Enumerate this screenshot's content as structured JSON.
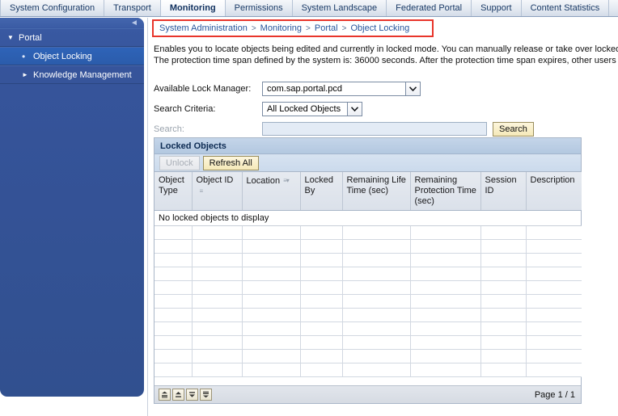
{
  "topnav": {
    "tabs": [
      {
        "label": "System Configuration",
        "active": false
      },
      {
        "label": "Transport",
        "active": false
      },
      {
        "label": "Monitoring",
        "active": true
      },
      {
        "label": "Permissions",
        "active": false
      },
      {
        "label": "System Landscape",
        "active": false
      },
      {
        "label": "Federated Portal",
        "active": false
      },
      {
        "label": "Support",
        "active": false
      },
      {
        "label": "Content Statistics",
        "active": false
      }
    ]
  },
  "sidebar": {
    "collapse_icon": "◄",
    "items": [
      {
        "label": "Portal",
        "icon": "▼",
        "level": 0,
        "selected": false
      },
      {
        "label": "Object Locking",
        "icon": "•",
        "level": 1,
        "selected": true
      },
      {
        "label": "Knowledge Management",
        "icon": "►",
        "level": 1,
        "selected": false
      }
    ]
  },
  "breadcrumb": {
    "highlight_color": "#e8352b",
    "separator": ">",
    "items": [
      "System Administration",
      "Monitoring",
      "Portal",
      "Object Locking"
    ]
  },
  "description": {
    "line1": "Enables you to locate objects being edited and currently in locked mode. You can manually release or take over locked",
    "line2": "The protection time span defined by the system is: 36000 seconds. After the protection time span expires, other users"
  },
  "form": {
    "lock_manager_label": "Available Lock Manager:",
    "lock_manager_value": "com.sap.portal.pcd",
    "search_criteria_label": "Search Criteria:",
    "search_criteria_value": "All Locked Objects",
    "search_label": "Search:",
    "search_value": "",
    "search_placeholder": "",
    "search_button": "Search",
    "dropdown_arrow": "⌄"
  },
  "panel": {
    "title": "Locked Objects",
    "unlock_button": "Unlock",
    "refresh_button": "Refresh All",
    "columns": [
      {
        "label": "Object Type",
        "sort": ""
      },
      {
        "label": "Object ID",
        "sort": "≡"
      },
      {
        "label": "Location",
        "sort": "≡▾"
      },
      {
        "label": "Locked By",
        "sort": ""
      },
      {
        "label": "Remaining Life Time (sec)",
        "sort": ""
      },
      {
        "label": "Remaining Protection Time (sec)",
        "sort": ""
      },
      {
        "label": "Session ID",
        "sort": ""
      },
      {
        "label": "Description",
        "sort": ""
      }
    ],
    "empty_message": "No locked objects to display",
    "blank_row_count": 11,
    "pager": {
      "first": "↥",
      "previous": "▲",
      "next": "▼",
      "last": "↧",
      "page_label": "Page 1 / 1"
    }
  }
}
